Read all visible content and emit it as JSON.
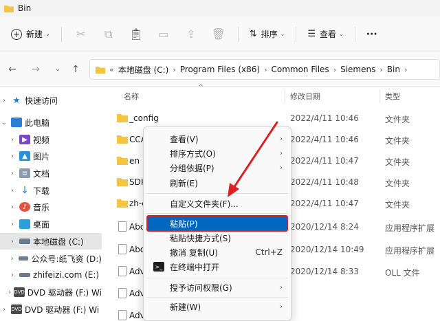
{
  "window": {
    "title": "Bin"
  },
  "toolbar": {
    "new_label": "新建",
    "sort_label": "排序",
    "view_label": "查看",
    "more_label": "···",
    "icons": [
      "cut-icon",
      "copy-icon",
      "paste-icon",
      "rename-icon",
      "share-icon",
      "delete-icon"
    ]
  },
  "address": {
    "lead": "«",
    "crumbs": [
      "本地磁盘 (C:)",
      "Program Files (x86)",
      "Common Files",
      "Siemens",
      "Bin"
    ]
  },
  "nav_pane": {
    "items": [
      {
        "label": "快速访问",
        "icon": "star-icon",
        "color": "#2a7fd4"
      },
      {
        "label": "此电脑",
        "icon": "computer-icon",
        "color": "#2a7fd4"
      },
      {
        "label": "视频",
        "icon": "video-icon",
        "color": "#7a47c9"
      },
      {
        "label": "图片",
        "icon": "image-icon",
        "color": "#2a8fd8"
      },
      {
        "label": "文档",
        "icon": "document-icon",
        "color": "#6b7c90"
      },
      {
        "label": "下载",
        "icon": "download-icon",
        "color": "#2a7fd4"
      },
      {
        "label": "音乐",
        "icon": "music-icon",
        "color": "#e0533f"
      },
      {
        "label": "桌面",
        "icon": "desktop-icon",
        "color": "#2a9fd8"
      },
      {
        "label": "本地磁盘 (C:)",
        "icon": "drive-icon",
        "color": "#6b7c90"
      },
      {
        "label": "公众号:纸飞资 (D:)",
        "icon": "drive-icon",
        "color": "#6b7c90"
      },
      {
        "label": "zhifeizi.com (E:)",
        "icon": "drive-icon",
        "color": "#6b7c90"
      },
      {
        "label": "DVD 驱动器 (F:) Wi",
        "icon": "dvd-icon",
        "color": "#4a4a4a"
      },
      {
        "label": "DVD 驱动器 (F:) Wi",
        "icon": "dvd-icon",
        "color": "#4a4a4a"
      }
    ]
  },
  "columns": {
    "name": "名称",
    "date": "修改日期",
    "type": "类型"
  },
  "files": [
    {
      "name": "_config",
      "date": "2022/4/11 10:46",
      "type": "文件夹",
      "kind": "folder"
    },
    {
      "name": "CCA",
      "date": "2022/4/11 10:46",
      "type": "文件夹",
      "kind": "folder"
    },
    {
      "name": "en",
      "date": "2022/4/11 10:47",
      "type": "文件夹",
      "kind": "folder"
    },
    {
      "name": "SDP",
      "date": "2022/4/11 10:48",
      "type": "文件夹",
      "kind": "folder"
    },
    {
      "name": "zh-c",
      "date": "2022/4/11 10:47",
      "type": "文件夹",
      "kind": "folder"
    },
    {
      "name": "Abo",
      "date": "2020/12/14 8:24",
      "type": "应用程序扩展",
      "kind": "file"
    },
    {
      "name": "Abo",
      "date": "2020/12/14 10:49",
      "type": "应用程序扩展",
      "kind": "file"
    },
    {
      "name": "Adv",
      "date": "2020/12/14 8:33",
      "type": "OLL 文件",
      "kind": "file"
    },
    {
      "name": "Adv",
      "date": "",
      "type": "",
      "kind": "file"
    },
    {
      "name": "Adv",
      "date": "",
      "type": "",
      "kind": "file"
    }
  ],
  "context_menu": {
    "view": "查看(V)",
    "sort": "排序方式(O)",
    "group": "分组依据(P)",
    "refresh": "刷新(E)",
    "customize": "自定义文件夹(F)...",
    "paste": "粘贴(P)",
    "paste_shortcut": "粘贴快捷方式(S)",
    "undo": "撤消 复制(U)",
    "undo_key": "Ctrl+Z",
    "terminal": "在终端中打开",
    "access": "授予访问权限(G)",
    "new": "新建(W)"
  },
  "colors": {
    "folder": "#f4c542",
    "accent": "#0067c0",
    "annotation": "#e02020"
  }
}
